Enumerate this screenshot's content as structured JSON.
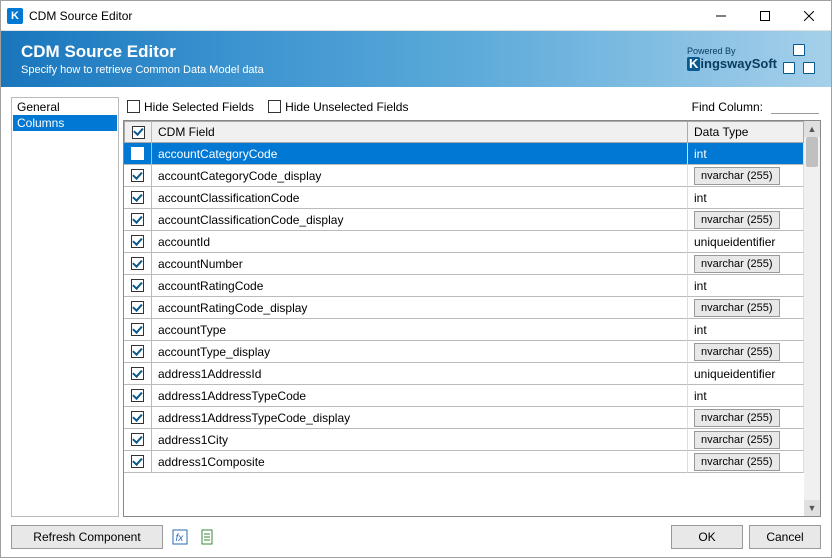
{
  "window": {
    "title": "CDM Source Editor"
  },
  "banner": {
    "title": "CDM Source Editor",
    "subtitle": "Specify how to retrieve Common Data Model data",
    "powered": "Powered By",
    "logo": "KingswaySoft"
  },
  "sidebar": {
    "items": [
      {
        "label": "General",
        "selected": false
      },
      {
        "label": "Columns",
        "selected": true
      }
    ]
  },
  "toolbar": {
    "hide_selected": "Hide Selected Fields",
    "hide_unselected": "Hide Unselected Fields",
    "find_label": "Find Column:",
    "find_value": ""
  },
  "table": {
    "header": {
      "check": true,
      "field": "CDM Field",
      "type": "Data Type"
    },
    "rows": [
      {
        "check": true,
        "field": "accountCategoryCode",
        "type": "int",
        "selected": true,
        "type_button": false
      },
      {
        "check": true,
        "field": "accountCategoryCode_display",
        "type": "nvarchar (255)",
        "type_button": true
      },
      {
        "check": true,
        "field": "accountClassificationCode",
        "type": "int",
        "type_button": false
      },
      {
        "check": true,
        "field": "accountClassificationCode_display",
        "type": "nvarchar (255)",
        "type_button": true
      },
      {
        "check": true,
        "field": "accountId",
        "type": "uniqueidentifier",
        "type_button": false
      },
      {
        "check": true,
        "field": "accountNumber",
        "type": "nvarchar (255)",
        "type_button": true
      },
      {
        "check": true,
        "field": "accountRatingCode",
        "type": "int",
        "type_button": false
      },
      {
        "check": true,
        "field": "accountRatingCode_display",
        "type": "nvarchar (255)",
        "type_button": true
      },
      {
        "check": true,
        "field": "accountType",
        "type": "int",
        "type_button": false
      },
      {
        "check": true,
        "field": "accountType_display",
        "type": "nvarchar (255)",
        "type_button": true
      },
      {
        "check": true,
        "field": "address1AddressId",
        "type": "uniqueidentifier",
        "type_button": false
      },
      {
        "check": true,
        "field": "address1AddressTypeCode",
        "type": "int",
        "type_button": false
      },
      {
        "check": true,
        "field": "address1AddressTypeCode_display",
        "type": "nvarchar (255)",
        "type_button": true
      },
      {
        "check": true,
        "field": "address1City",
        "type": "nvarchar (255)",
        "type_button": true
      },
      {
        "check": true,
        "field": "address1Composite",
        "type": "nvarchar (255)",
        "type_button": true
      }
    ]
  },
  "footer": {
    "refresh": "Refresh Component",
    "ok": "OK",
    "cancel": "Cancel"
  }
}
